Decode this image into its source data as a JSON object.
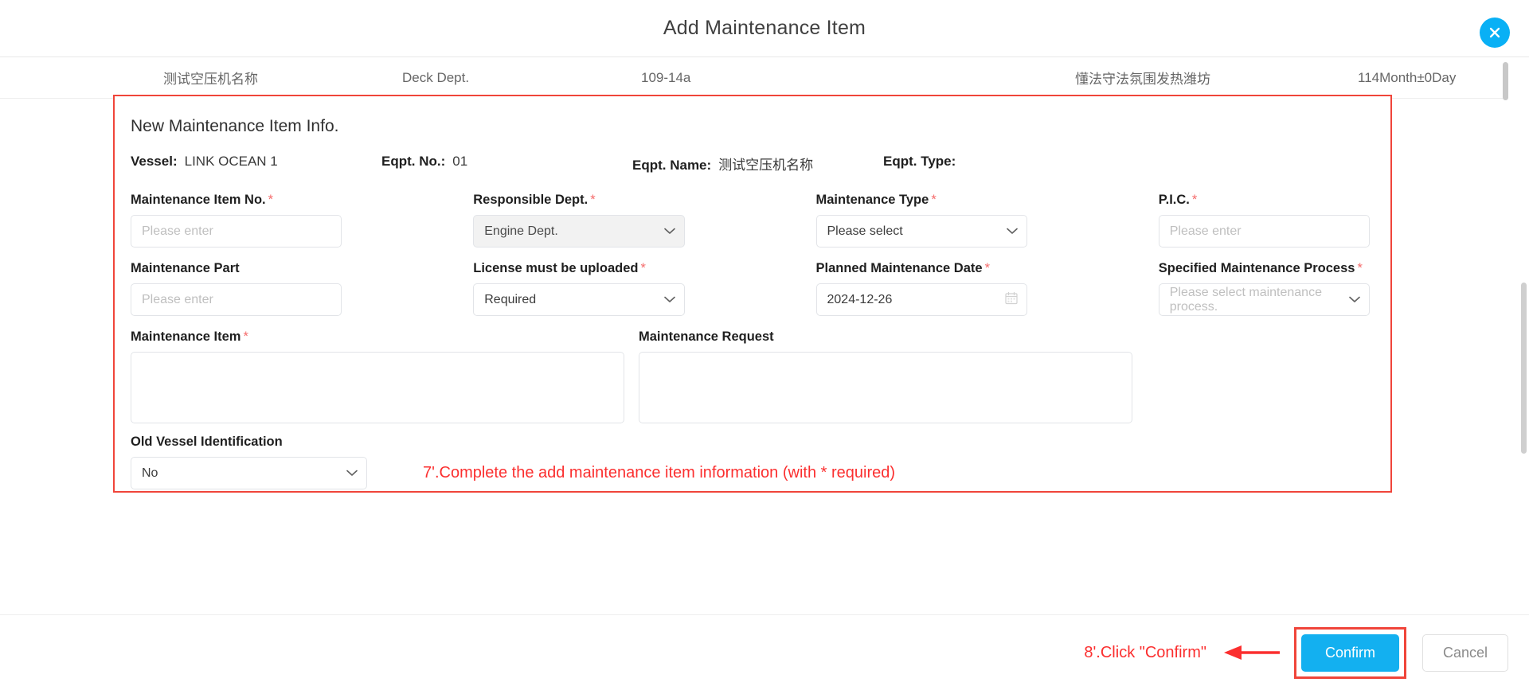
{
  "header": {
    "title": "Add Maintenance Item",
    "close_icon": "close-icon"
  },
  "table_strip": {
    "row": [
      "测试空压机名称",
      "Deck Dept.",
      "109-14a",
      "懂法守法氛围发热潍坊",
      "114Month±0Day"
    ]
  },
  "form": {
    "section_title": "New Maintenance Item Info.",
    "info": [
      {
        "label": "Vessel:",
        "value": "LINK OCEAN 1"
      },
      {
        "label": "Eqpt. No.:",
        "value": "01"
      },
      {
        "label": "Eqpt. Name:",
        "value": "测试空压机名称"
      },
      {
        "label": "Eqpt. Type:",
        "value": ""
      }
    ],
    "fields": {
      "maintenance_item_no": {
        "label": "Maintenance Item No.",
        "required": "*",
        "value": "Please enter"
      },
      "responsible_dept": {
        "label": "Responsible Dept.",
        "required": "*",
        "value": "Engine Dept."
      },
      "maintenance_type": {
        "label": "Maintenance Type",
        "required": "*",
        "value": "Please select"
      },
      "pic": {
        "label": "P.I.C.",
        "required": "*",
        "value": "Please enter"
      },
      "maintenance_part": {
        "label": "Maintenance Part",
        "required": "",
        "value": "Please enter"
      },
      "license_must_be_uploaded": {
        "label": "License must be uploaded",
        "required": "*",
        "value": "Required"
      },
      "planned_maintenance_date": {
        "label": "Planned Maintenance Date",
        "required": "*",
        "value": "2024-12-26"
      },
      "specified_maintenance_process": {
        "label": "Specified Maintenance Process",
        "required": "*",
        "value": "Please select maintenance process."
      },
      "maintenance_item": {
        "label": "Maintenance Item",
        "required": "*",
        "value": ""
      },
      "maintenance_request": {
        "label": "Maintenance Request",
        "required": "",
        "value": ""
      },
      "old_vessel_identification": {
        "label": "Old Vessel Identification",
        "required": "",
        "value": "No"
      }
    },
    "note": "7'.Complete the add maintenance item information (with * required)"
  },
  "footer": {
    "note": "8'.Click \"Confirm\"",
    "confirm_label": "Confirm",
    "cancel_label": "Cancel"
  },
  "colors": {
    "accent": "#13b0f0",
    "annotation_red": "#fb2f2f",
    "required_star": "#f56c6c"
  }
}
